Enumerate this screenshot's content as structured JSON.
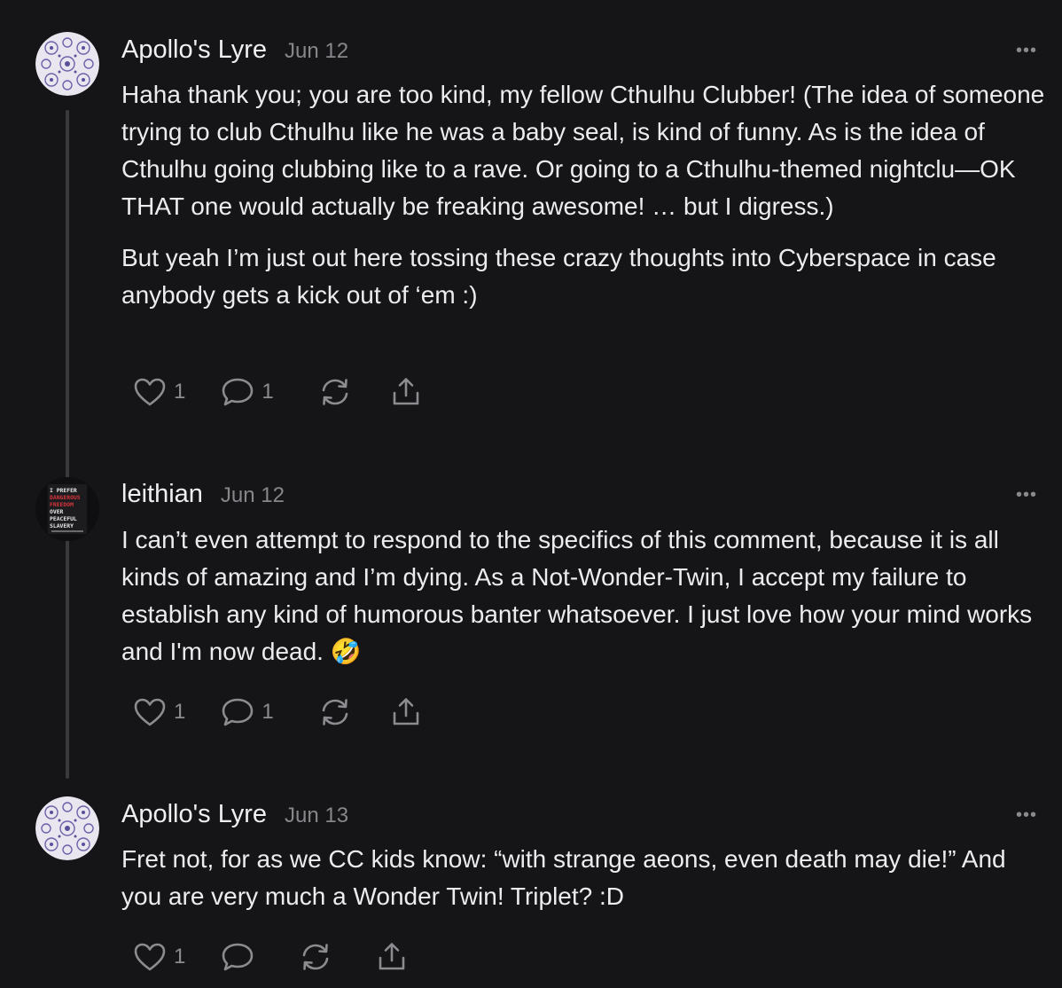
{
  "comments": [
    {
      "author": "Apollo's Lyre",
      "date": "Jun 12",
      "paragraphs": [
        "Haha thank you; you are too kind, my fellow Cthulhu Clubber! (The idea of someone trying to club Cthulhu like he was a baby seal, is kind of funny. As is the idea of Cthulhu going clubbing like to a rave. Or going to a Cthulhu-themed nightclu—OK THAT one would actually be freaking awesome! … but I digress.)",
        "But yeah I’m just out here tossing these crazy thoughts into Cyberspace in case anybody gets a kick out of ‘em :)"
      ],
      "likes": "1",
      "replies": "1",
      "more": "•••"
    },
    {
      "author": "leithian",
      "date": "Jun 12",
      "paragraphs": [
        "I can’t even attempt to respond to the specifics of this comment, because it is all kinds of amazing and I’m dying. As a Not-Wonder-Twin, I accept my failure to establish any kind of humorous banter whatsoever. I just love how your mind works and I'm now dead. 🤣"
      ],
      "likes": "1",
      "replies": "1",
      "more": "•••",
      "avatar_text": [
        "I PREFER",
        "DANGEROUS",
        "FREEDOM",
        "OVER",
        "PEACEFUL",
        "SLAVERY"
      ]
    },
    {
      "author": "Apollo's Lyre",
      "date": "Jun 13",
      "paragraphs": [
        "Fret not, for as we CC kids know: “with strange aeons, even death may die!” And you are very much a Wonder Twin! Triplet? :D"
      ],
      "likes": "1",
      "replies": "",
      "more": "•••"
    }
  ],
  "icons": {
    "like": "heart-icon",
    "reply": "speech-bubble-icon",
    "restack": "restack-icon",
    "share": "share-icon"
  },
  "colors": {
    "background": "#151517",
    "text": "#ececee",
    "muted": "#86868b",
    "thread_line": "#3a3a3d"
  }
}
